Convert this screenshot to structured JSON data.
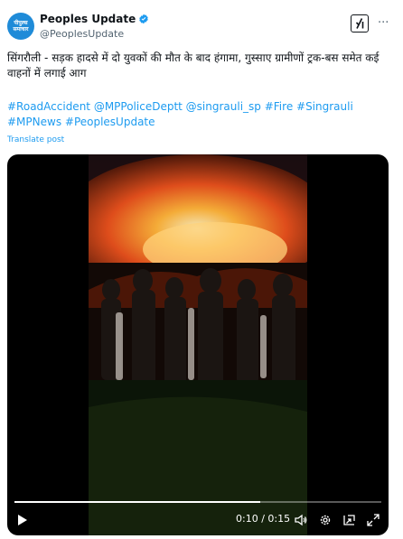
{
  "author": {
    "avatar_line1": "पीपुल्स",
    "avatar_line2": "समाचार",
    "name": "Peoples Update",
    "handle": "@PeoplesUpdate"
  },
  "tweet": {
    "text": "सिंगरौली - सड़क हादसे में दो युवकों की मौत के बाद हंगामा, गुस्साए ग्रामीणों ट्रक-बस समेत कई वाहनों में लगाई आग",
    "hashtags": "#RoadAccident @MPPoliceDeptt @singrauli_sp #Fire #Singrauli #MPNews #PeoplesUpdate",
    "translate_label": "Translate post"
  },
  "video": {
    "current_time": "0:10",
    "separator": "/",
    "duration": "0:15",
    "progress": 0.67
  },
  "colors": {
    "link": "#1d9bf0",
    "verified": "#1d9bf0",
    "avatar_bg": "#1f8bd8"
  },
  "icons": [
    "verified-badge-icon",
    "grok-icon",
    "more-icon",
    "play-icon",
    "volume-icon",
    "settings-icon",
    "pip-icon",
    "fullscreen-icon"
  ]
}
